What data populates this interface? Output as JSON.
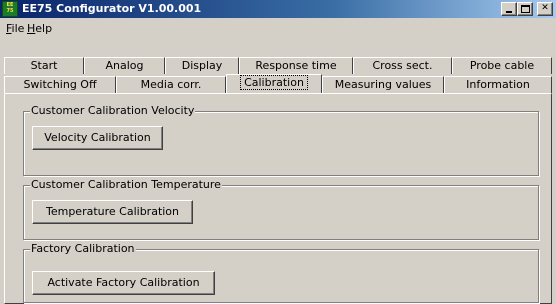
{
  "window": {
    "title": "EE75 Configurator V1.00.001",
    "icon_name": "ee-app-icon",
    "icon_text": [
      "EE",
      "75"
    ]
  },
  "menu": {
    "items": [
      {
        "label": "File",
        "mnemonic": "F",
        "rest": "ile"
      },
      {
        "label": "Help",
        "mnemonic": "H",
        "rest": "elp"
      }
    ]
  },
  "tabs": {
    "row1": [
      "Start",
      "Analog",
      "Display",
      "Response time",
      "Cross sect.",
      "Probe cable"
    ],
    "row2": [
      "Switching Off",
      "Media corr.",
      "Calibration",
      "Measuring values",
      "Information"
    ],
    "active": "Calibration"
  },
  "groups": [
    {
      "legend": "Customer Calibration Velocity",
      "button": "Velocity Calibration"
    },
    {
      "legend": "Customer Calibration Temperature",
      "button": "Temperature Calibration"
    },
    {
      "legend": "Factory Calibration",
      "button": "Activate Factory Calibration"
    }
  ],
  "colors": {
    "titlebar_start": "#0a246a",
    "titlebar_end": "#a6caf0",
    "face": "#d4d0c8"
  }
}
